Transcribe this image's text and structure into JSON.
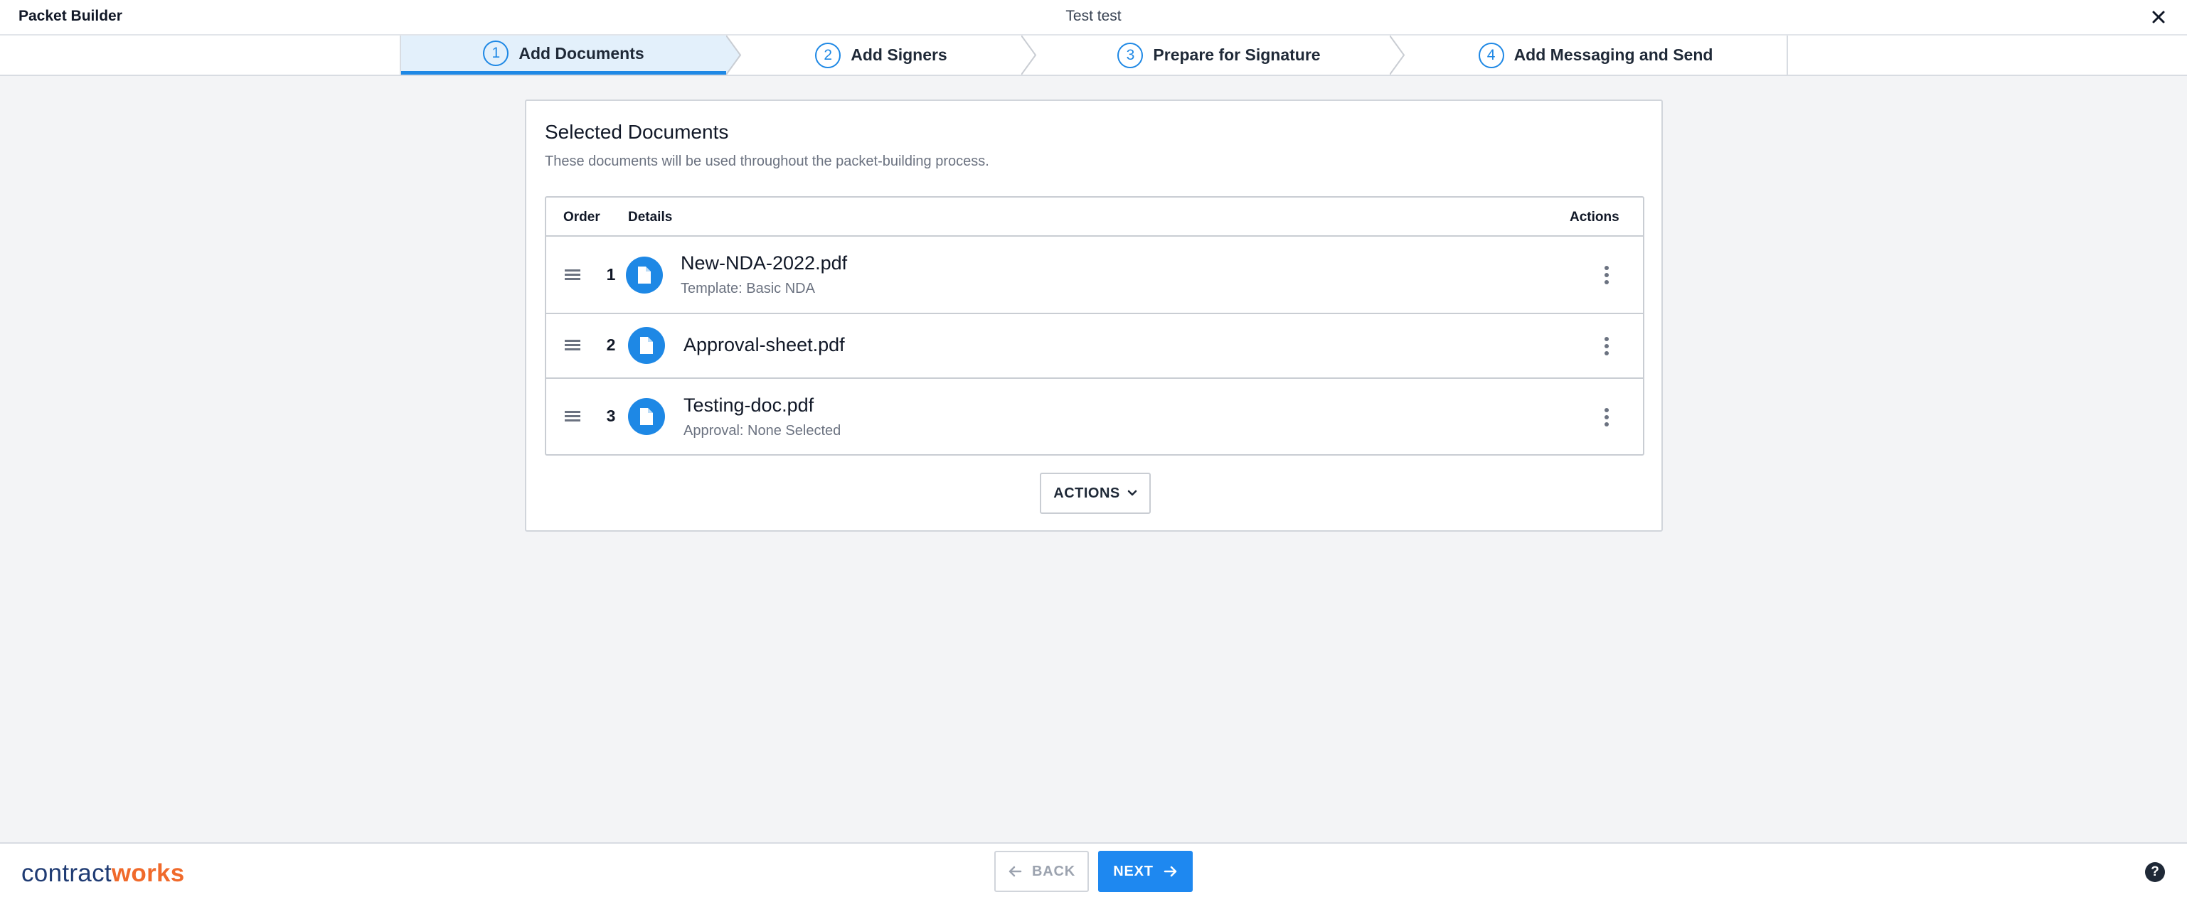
{
  "header": {
    "app_title": "Packet Builder",
    "packet_name": "Test test",
    "close_icon": "close-icon"
  },
  "stepper": {
    "active_step": 1,
    "steps": [
      {
        "number": "1",
        "label": "Add Documents"
      },
      {
        "number": "2",
        "label": "Add Signers"
      },
      {
        "number": "3",
        "label": "Prepare for Signature"
      },
      {
        "number": "4",
        "label": "Add Messaging and Send"
      }
    ]
  },
  "card": {
    "title": "Selected Documents",
    "subtitle": "These documents will be used throughout the packet-building process.",
    "columns": {
      "order": "Order",
      "details": "Details",
      "actions": "Actions"
    },
    "documents": [
      {
        "order": "1",
        "name": "New-NDA-2022.pdf",
        "meta": "Template: Basic NDA"
      },
      {
        "order": "2",
        "name": "Approval-sheet.pdf",
        "meta": ""
      },
      {
        "order": "3",
        "name": "Testing-doc.pdf",
        "meta": "Approval: None Selected"
      }
    ],
    "actions_label": "ACTIONS"
  },
  "footer": {
    "logo_part1": "contract",
    "logo_part2": "works",
    "back_label": "BACK",
    "next_label": "NEXT",
    "help_symbol": "?"
  },
  "colors": {
    "accent": "#1e88e5",
    "active_step_bg": "#e3f0fb",
    "logo_dark": "#1f3b73",
    "logo_orange": "#f06a2b"
  }
}
